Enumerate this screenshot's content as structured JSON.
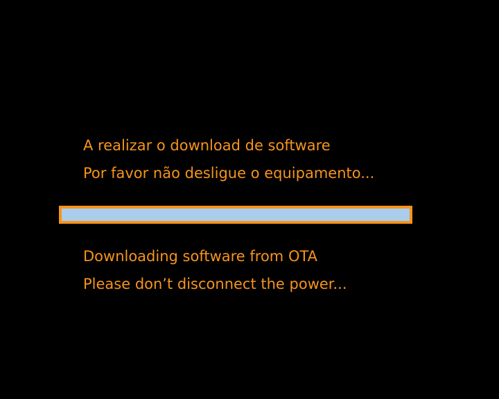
{
  "messages": {
    "pt_line1": "A realizar o download de software",
    "pt_line2": "Por favor não desligue o equipamento...",
    "en_line1": "Downloading software from OTA",
    "en_line2": "Please don’t disconnect the power..."
  },
  "progress": {
    "fraction": 1.0
  },
  "colors": {
    "background": "#000000",
    "text": "#f7941d",
    "progress_border": "#f7941d",
    "progress_fill": "#a9cdeb"
  }
}
